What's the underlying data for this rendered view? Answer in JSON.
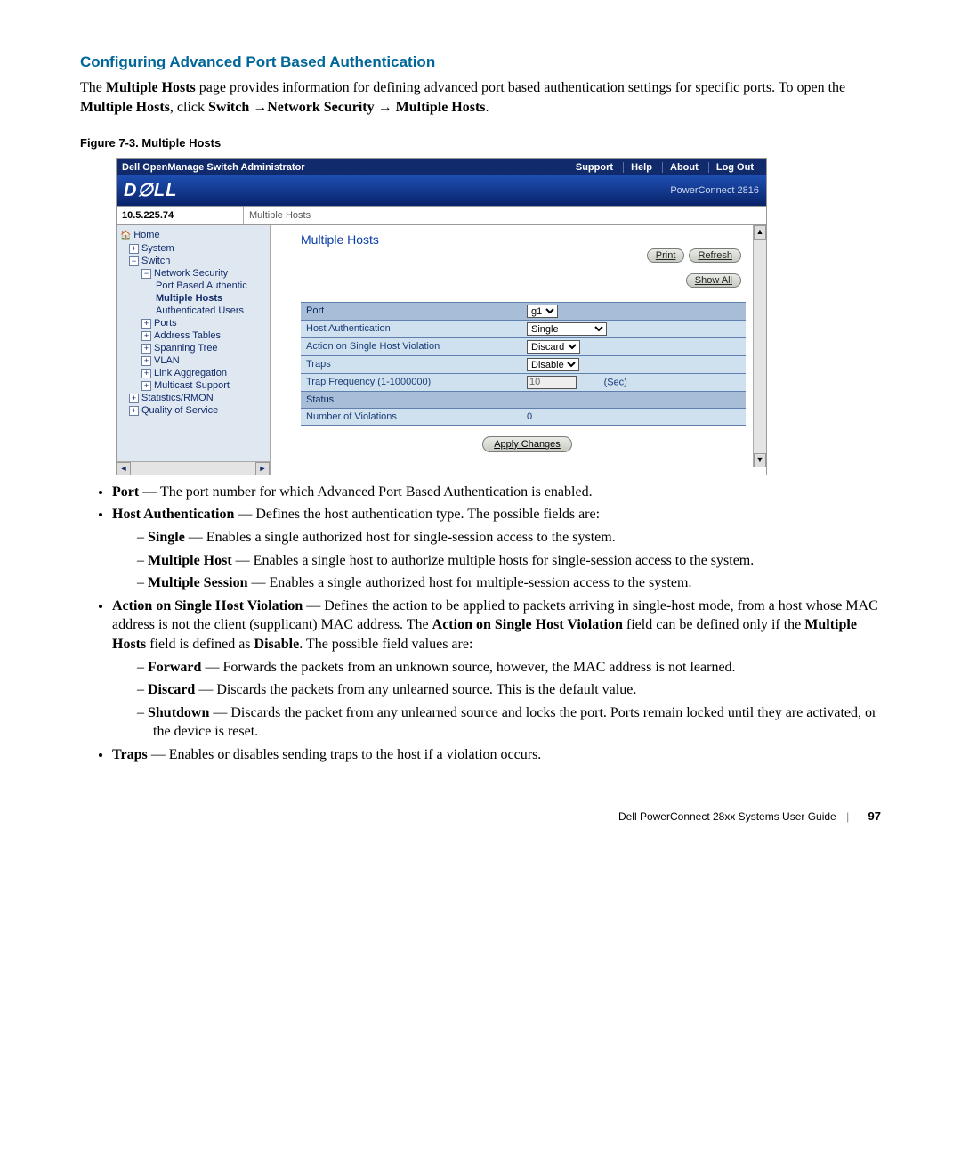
{
  "heading": "Configuring Advanced Port Based Authentication",
  "intro_parts": {
    "a": "The ",
    "b": "Multiple Hosts",
    "c": " page provides information for defining advanced port based authentication settings for specific ports. To open the ",
    "d": "Multiple Hosts",
    "e": ", click ",
    "f": "Switch",
    "nav1": "Network Security",
    "nav2": "Multiple Hosts",
    "period": "."
  },
  "figure_caption": "Figure 7-3.    Multiple Hosts",
  "shot": {
    "titlebar": "Dell OpenManage Switch Administrator",
    "nav": {
      "support": "Support",
      "help": "Help",
      "about": "About",
      "logout": "Log Out"
    },
    "logo": "D∅LL",
    "product": "PowerConnect 2816",
    "ip": "10.5.225.74",
    "breadcrumb": "Multiple Hosts",
    "tree": {
      "home": "Home",
      "system": "System",
      "switch": "Switch",
      "netsec": "Network Security",
      "pba": "Port Based Authentic",
      "mh": "Multiple Hosts",
      "au": "Authenticated Users",
      "ports": "Ports",
      "addr": "Address Tables",
      "stp": "Spanning Tree",
      "vlan": "VLAN",
      "lag": "Link Aggregation",
      "mc": "Multicast Support",
      "stats": "Statistics/RMON",
      "qos": "Quality of Service"
    },
    "panel": {
      "title": "Multiple Hosts",
      "print": "Print",
      "refresh": "Refresh",
      "showall": "Show All",
      "rows": {
        "port_lbl": "Port",
        "port_val": "g1",
        "hostauth_lbl": "Host Authentication",
        "hostauth_val": "Single",
        "action_lbl": "Action on Single Host Violation",
        "action_val": "Discard",
        "traps_lbl": "Traps",
        "traps_val": "Disable",
        "freq_lbl": "Trap Frequency (1-1000000)",
        "freq_val": "10",
        "freq_unit": "(Sec)",
        "status_hdr": "Status",
        "nov_lbl": "Number of Violations",
        "nov_val": "0"
      },
      "apply": "Apply Changes"
    }
  },
  "bullets": {
    "port": {
      "b": "Port",
      "t": " — The port number for which Advanced Port Based Authentication is enabled."
    },
    "hostauth": {
      "b": "Host Authentication",
      "t": " — Defines the host authentication type. The possible fields are:"
    },
    "single": {
      "b": "Single",
      "t": " — Enables a single authorized host for single-session access to the system."
    },
    "mh": {
      "b": "Multiple Host",
      "t": " — Enables a single host to authorize multiple hosts for single-session access to the system."
    },
    "ms": {
      "b": "Multiple Session",
      "t": " — Enables a single authorized host for multiple-session access to the system."
    },
    "action": {
      "b": "Action on Single Host Violation",
      "t1": " — Defines the action to be applied to packets arriving in single-host mode, from a host whose MAC address is not the client (supplicant) MAC address. The ",
      "b2": "Action on Single Host Violation",
      "t2": " field can be defined only if the ",
      "b3": "Multiple Hosts",
      "t3": " field is defined as ",
      "b4": "Disable",
      "t4": ". The possible field values are:"
    },
    "fwd": {
      "b": "Forward",
      "t": " — Forwards the packets from an unknown source, however, the MAC address is not learned."
    },
    "dsc": {
      "b": "Discard",
      "t": " — Discards the packets from any unlearned source. This is the default value."
    },
    "shd": {
      "b": "Shutdown",
      "t": " — Discards the packet from any unlearned source and locks the port. Ports remain locked until they are activated, or the device is reset."
    },
    "traps": {
      "b": "Traps",
      "t": " — Enables or disables sending traps to the host if a violation occurs."
    }
  },
  "footer": {
    "guide": "Dell PowerConnect 28xx Systems User Guide",
    "page": "97"
  }
}
